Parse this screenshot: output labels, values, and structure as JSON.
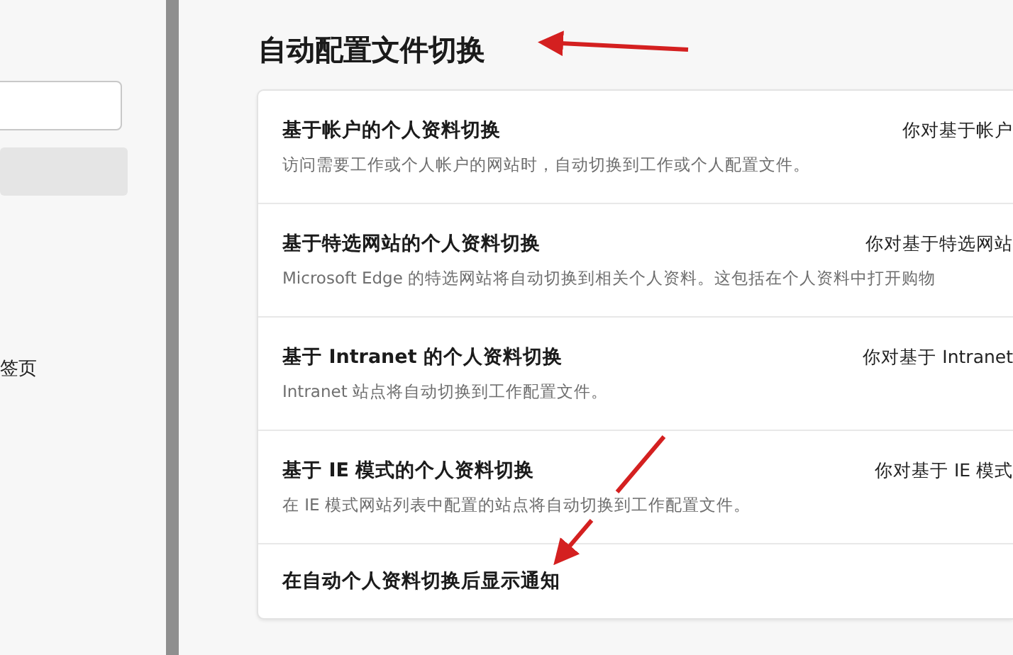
{
  "sidebar": {
    "items": [
      {
        "selected": true
      },
      {
        "label": "签页",
        "selected": false
      }
    ]
  },
  "section": {
    "title": "自动配置文件切换"
  },
  "settings": [
    {
      "title": "基于帐户的个人资料切换",
      "description": "访问需要工作或个人帐户的网站时，自动切换到工作或个人配置文件。",
      "value": "你对基于帐户"
    },
    {
      "title": "基于特选网站的个人资料切换",
      "description": "Microsoft Edge 的特选网站将自动切换到相关个人资料。这包括在个人资料中打开购物",
      "value": "你对基于特选网站"
    },
    {
      "title": "基于 Intranet 的个人资料切换",
      "description": "Intranet 站点将自动切换到工作配置文件。",
      "value": "你对基于 Intranet"
    },
    {
      "title": "基于 IE 模式的个人资料切换",
      "description": "在 IE 模式网站列表中配置的站点将自动切换到工作配置文件。",
      "value": "你对基于 IE 模式"
    },
    {
      "title": "在自动个人资料切换后显示通知"
    }
  ]
}
